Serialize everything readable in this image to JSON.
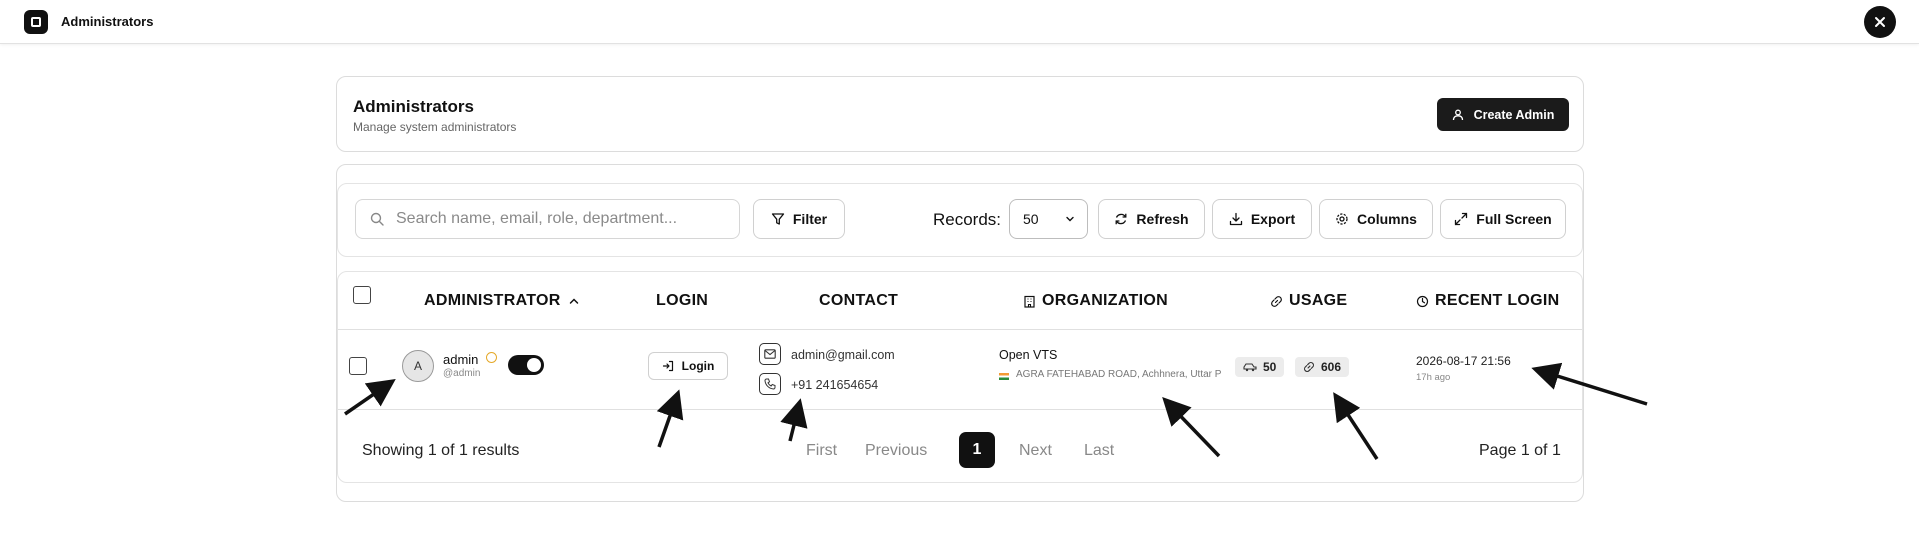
{
  "app": {
    "title": "Administrators"
  },
  "header": {
    "title": "Administrators",
    "subtitle": "Manage system administrators",
    "create_label": "Create Admin"
  },
  "toolbar": {
    "search_placeholder": "Search name, email, role, department...",
    "filter_label": "Filter",
    "records_label": "Records:",
    "records_value": "50",
    "refresh_label": "Refresh",
    "export_label": "Export",
    "columns_label": "Columns",
    "fullscreen_label": "Full Screen"
  },
  "table": {
    "columns": [
      "ADMINISTRATOR",
      "LOGIN",
      "CONTACT",
      "ORGANIZATION",
      "USAGE",
      "RECENT LOGIN"
    ],
    "rows": [
      {
        "avatar_initial": "A",
        "name": "admin",
        "handle": "@admin",
        "active": true,
        "login_label": "Login",
        "email": "admin@gmail.com",
        "phone": "+91 241654654",
        "org_name": "Open VTS",
        "org_address": "AGRA FATEHABAD ROAD, Achhnera, Uttar P",
        "vehicles": "50",
        "usage": "606",
        "recent_login": "2026-08-17 21:56",
        "recent_ago": "17h ago"
      }
    ]
  },
  "footer": {
    "showing": "Showing 1 of 1 results",
    "first": "First",
    "previous": "Previous",
    "current_page": "1",
    "next": "Next",
    "last": "Last",
    "page_info": "Page 1 of 1"
  },
  "colors": {
    "primary": "#1b1b1b",
    "border": "#dcdcdc",
    "verified": "#e5a92a"
  }
}
